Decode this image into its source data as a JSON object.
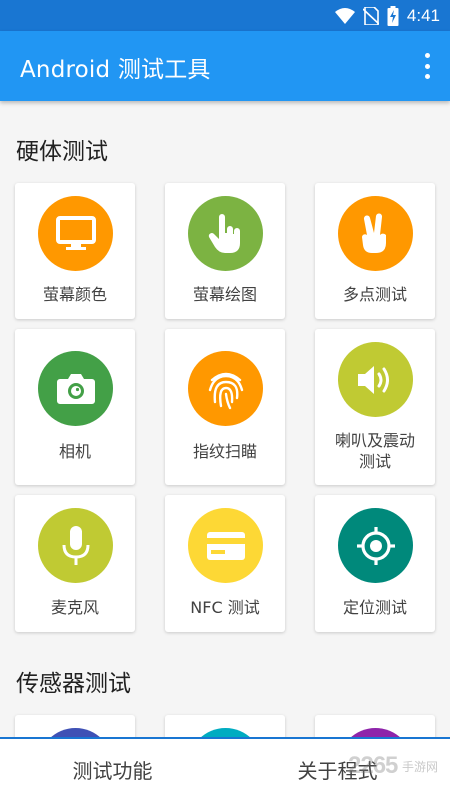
{
  "status_bar": {
    "time": "4:41"
  },
  "app_bar": {
    "title": "Android 测试工具"
  },
  "sections": [
    {
      "title": "硬体测试"
    },
    {
      "title": "传感器测试"
    }
  ],
  "cards": [
    {
      "label": "萤幕颜色",
      "color": "#ff9800",
      "icon": "monitor-icon"
    },
    {
      "label": "萤幕绘图",
      "color": "#7cb342",
      "icon": "touch-finger-icon"
    },
    {
      "label": "多点测试",
      "color": "#ff9800",
      "icon": "two-fingers-icon"
    },
    {
      "label": "相机",
      "color": "#43a047",
      "icon": "camera-icon"
    },
    {
      "label": "指纹扫瞄",
      "color": "#ff9800",
      "icon": "fingerprint-icon"
    },
    {
      "label": "喇叭及震动\n测试",
      "color": "#c0ca33",
      "icon": "speaker-icon"
    },
    {
      "label": "麦克风",
      "color": "#c0ca33",
      "icon": "microphone-icon"
    },
    {
      "label": "NFC 测试",
      "color": "#fdd835",
      "icon": "card-icon"
    },
    {
      "label": "定位测试",
      "color": "#00897b",
      "icon": "location-target-icon"
    }
  ],
  "partial_cards": [
    {
      "color": "#3f51b5"
    },
    {
      "color": "#00acc1"
    },
    {
      "color": "#8e24aa"
    }
  ],
  "bottom_nav": {
    "tabs": [
      {
        "label": "测试功能"
      },
      {
        "label": "关于程式"
      }
    ]
  },
  "watermark": {
    "text": "2265",
    "sub": "手游网"
  }
}
